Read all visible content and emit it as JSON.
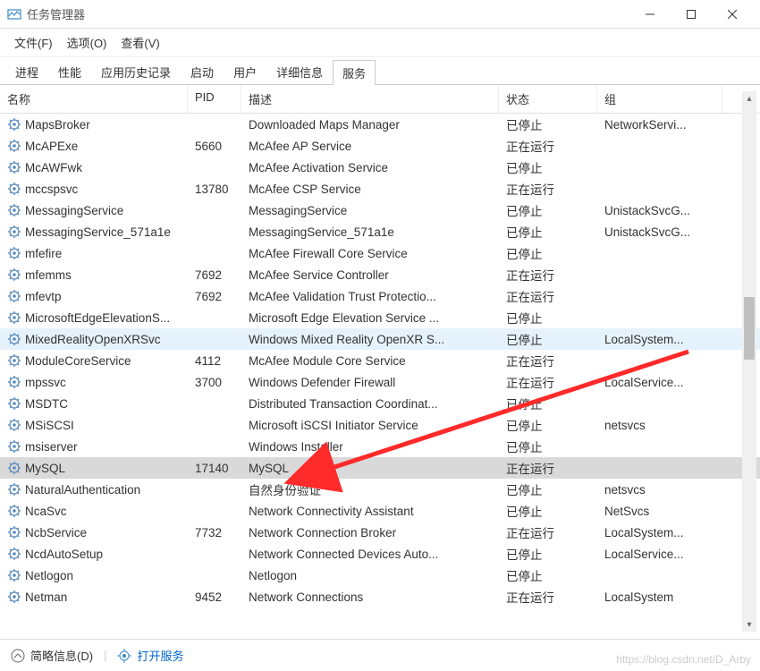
{
  "window": {
    "title": "任务管理器"
  },
  "menu": {
    "file": "文件(F)",
    "options": "选项(O)",
    "view": "查看(V)"
  },
  "tabs": {
    "items": [
      "进程",
      "性能",
      "应用历史记录",
      "启动",
      "用户",
      "详细信息",
      "服务"
    ],
    "active_index": 6
  },
  "columns": {
    "name": "名称",
    "pid": "PID",
    "desc": "描述",
    "status": "状态",
    "group": "组"
  },
  "status": {
    "stopped": "已停止",
    "running": "正在运行"
  },
  "services": [
    {
      "name": "MapsBroker",
      "pid": "",
      "desc": "Downloaded Maps Manager",
      "status": "已停止",
      "group": "NetworkServi..."
    },
    {
      "name": "McAPExe",
      "pid": "5660",
      "desc": "McAfee AP Service",
      "status": "正在运行",
      "group": ""
    },
    {
      "name": "McAWFwk",
      "pid": "",
      "desc": "McAfee Activation Service",
      "status": "已停止",
      "group": ""
    },
    {
      "name": "mccspsvc",
      "pid": "13780",
      "desc": "McAfee CSP Service",
      "status": "正在运行",
      "group": ""
    },
    {
      "name": "MessagingService",
      "pid": "",
      "desc": "MessagingService",
      "status": "已停止",
      "group": "UnistackSvcG..."
    },
    {
      "name": "MessagingService_571a1e",
      "pid": "",
      "desc": "MessagingService_571a1e",
      "status": "已停止",
      "group": "UnistackSvcG..."
    },
    {
      "name": "mfefire",
      "pid": "",
      "desc": "McAfee Firewall Core Service",
      "status": "已停止",
      "group": ""
    },
    {
      "name": "mfemms",
      "pid": "7692",
      "desc": "McAfee Service Controller",
      "status": "正在运行",
      "group": ""
    },
    {
      "name": "mfevtp",
      "pid": "7692",
      "desc": "McAfee Validation Trust Protectio...",
      "status": "正在运行",
      "group": ""
    },
    {
      "name": "MicrosoftEdgeElevationS...",
      "pid": "",
      "desc": "Microsoft Edge Elevation Service ...",
      "status": "已停止",
      "group": ""
    },
    {
      "name": "MixedRealityOpenXRSvc",
      "pid": "",
      "desc": "Windows Mixed Reality OpenXR S...",
      "status": "已停止",
      "group": "LocalSystem...",
      "selected": true
    },
    {
      "name": "ModuleCoreService",
      "pid": "4112",
      "desc": "McAfee Module Core Service",
      "status": "正在运行",
      "group": ""
    },
    {
      "name": "mpssvc",
      "pid": "3700",
      "desc": "Windows Defender Firewall",
      "status": "正在运行",
      "group": "LocalService..."
    },
    {
      "name": "MSDTC",
      "pid": "",
      "desc": "Distributed Transaction Coordinat...",
      "status": "已停止",
      "group": ""
    },
    {
      "name": "MSiSCSI",
      "pid": "",
      "desc": "Microsoft iSCSI Initiator Service",
      "status": "已停止",
      "group": "netsvcs"
    },
    {
      "name": "msiserver",
      "pid": "",
      "desc": "Windows Installer",
      "status": "已停止",
      "group": ""
    },
    {
      "name": "MySQL",
      "pid": "17140",
      "desc": "MySQL",
      "status": "正在运行",
      "group": "",
      "highlight": true
    },
    {
      "name": "NaturalAuthentication",
      "pid": "",
      "desc": "自然身份验证",
      "status": "已停止",
      "group": "netsvcs"
    },
    {
      "name": "NcaSvc",
      "pid": "",
      "desc": "Network Connectivity Assistant",
      "status": "已停止",
      "group": "NetSvcs"
    },
    {
      "name": "NcbService",
      "pid": "7732",
      "desc": "Network Connection Broker",
      "status": "正在运行",
      "group": "LocalSystem..."
    },
    {
      "name": "NcdAutoSetup",
      "pid": "",
      "desc": "Network Connected Devices Auto...",
      "status": "已停止",
      "group": "LocalService..."
    },
    {
      "name": "Netlogon",
      "pid": "",
      "desc": "Netlogon",
      "status": "已停止",
      "group": ""
    },
    {
      "name": "Netman",
      "pid": "9452",
      "desc": "Network Connections",
      "status": "正在运行",
      "group": "LocalSystem"
    }
  ],
  "footer": {
    "brief": "简略信息(D)",
    "open_services": "打开服务"
  },
  "watermark": "https://blog.csdn.net/D_Arby"
}
